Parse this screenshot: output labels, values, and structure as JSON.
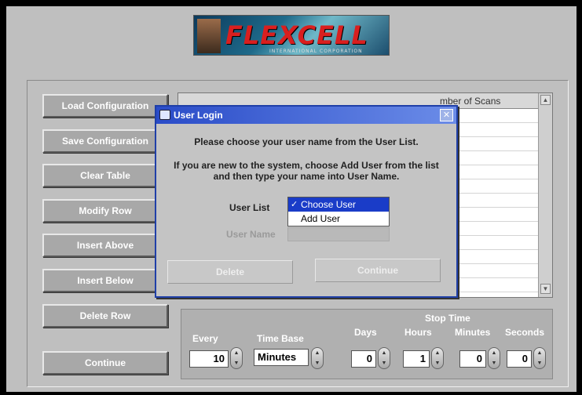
{
  "logo": {
    "text": "FLEXCELL",
    "subtext": "INTERNATIONAL CORPORATION"
  },
  "buttons": {
    "load": "Load Configuration",
    "save": "Save Configuration",
    "clear": "Clear Table",
    "modify": "Modify Row",
    "insert_above": "Insert Above",
    "insert_below": "Insert Below",
    "delete_row": "Delete Row",
    "continue": "Continue"
  },
  "table": {
    "visible_header": "mber of Scans"
  },
  "time_panel": {
    "every_label": "Every",
    "every_value": "10",
    "time_base_label": "Time Base",
    "time_base_value": "Minutes",
    "stop_time_label": "Stop Time",
    "days_label": "Days",
    "days_value": "0",
    "hours_label": "Hours",
    "hours_value": "1",
    "minutes_label": "Minutes",
    "minutes_value": "0",
    "seconds_label": "Seconds",
    "seconds_value": "0"
  },
  "dialog": {
    "title": "User Login",
    "line1": "Please choose your user name from the User List.",
    "line2": "If you are new to the system, choose Add User from the list",
    "line3": "and then type your name into User Name.",
    "user_list_label": "User List",
    "user_list_options": [
      "Choose User",
      "Add User"
    ],
    "selected_option": "Choose User",
    "user_name_label": "User Name",
    "user_name_value": "",
    "delete_label": "Delete",
    "continue_label": "Continue"
  },
  "colors": {
    "title_bar": "#2a4cc8",
    "selection": "#1a3cc8",
    "button_face": "#a8a8a8"
  }
}
